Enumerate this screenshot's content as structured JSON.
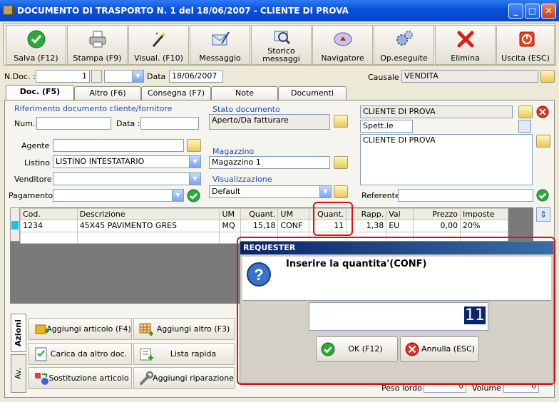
{
  "window": {
    "title": "DOCUMENTO DI TRASPORTO N. 1   del 18/06/2007 - CLIENTE DI PROVA"
  },
  "toolbar": [
    {
      "label": "Salva (F12)",
      "icon": "save-check-icon",
      "name": "save-button"
    },
    {
      "label": "Stampa (F9)",
      "icon": "printer-icon",
      "name": "print-button"
    },
    {
      "label": "Visual. (F10)",
      "icon": "magic-wand-icon",
      "name": "preview-button"
    },
    {
      "label": "Messaggio",
      "icon": "envelope-pen-icon",
      "name": "message-button"
    },
    {
      "label": "Storico messaggi",
      "icon": "message-history-icon",
      "name": "message-history-button"
    },
    {
      "label": "Navigatore",
      "icon": "compass-icon",
      "name": "navigator-button"
    },
    {
      "label": "Op.eseguite",
      "icon": "gears-icon",
      "name": "operations-button"
    },
    {
      "label": "Elimina",
      "icon": "red-x-icon",
      "name": "delete-button"
    },
    {
      "label": "Uscita (ESC)",
      "icon": "exit-icon",
      "name": "exit-button"
    }
  ],
  "header": {
    "ndoc_label": "N.Doc. :",
    "ndoc_value": "1",
    "data_label": "Data :",
    "data_value": "18/06/2007",
    "causale_label": "Causale :",
    "causale_value": "VENDITA"
  },
  "tabs": [
    "Doc. (F5)",
    "Altro (F6)",
    "Consegna (F7)",
    "Note",
    "Documenti"
  ],
  "rif": {
    "title": "Riferimento documento cliente/fornitore",
    "num_label": "Num.:",
    "num_value": "",
    "data_label": "Data :",
    "data_value": ""
  },
  "left": {
    "agente_label": "Agente :",
    "agente_value": "",
    "listino_label": "Listino :",
    "listino_value": "LISTINO INTESTATARIO",
    "venditore_label": "Venditore :",
    "venditore_value": "",
    "pagamento_label": "Pagamento :",
    "pagamento_value": ""
  },
  "stato": {
    "title": "Stato documento",
    "value": "Aperto/Da fatturare"
  },
  "magazzino": {
    "title": "Magazzino",
    "value": "Magazzino 1"
  },
  "visualizzazione": {
    "title": "Visualizzazione",
    "value": "Default"
  },
  "cliente": {
    "name": "CLIENTE DI PROVA",
    "salutation": "Spett.le",
    "address": "CLIENTE DI PROVA",
    "referente_label": "Referente",
    "referente_value": ""
  },
  "grid": {
    "headers": [
      "Cod.",
      "Descrizione",
      "UM",
      "Quant.",
      "UM",
      "Quant.",
      "Rapp.",
      "Val",
      "Prezzo",
      "Imposte"
    ],
    "rows": [
      [
        "1234",
        "45X45 PAVIMENTO GRES",
        "MQ",
        "15,18",
        "CONF",
        "11",
        "1,38",
        "EU",
        "0,00",
        "20%"
      ]
    ]
  },
  "side_tabs": [
    "Azioni",
    "Av."
  ],
  "actions": [
    "Aggiungi articolo (F4)",
    "Aggiungi altro (F3)",
    "Carica da altro doc.",
    "Lista rapida",
    "Sostituzione articolo",
    "Aggiungi riparazione"
  ],
  "footer": {
    "peso_label": "Peso lordo :",
    "peso_value": "0",
    "volume_label": "Volume :",
    "volume_value": "0"
  },
  "dialog": {
    "title": "REQUESTER",
    "prompt": "Inserire la quantita'(CONF)",
    "value": "11",
    "ok": "OK (F12)",
    "cancel": "Annulla (ESC)"
  },
  "colors": {
    "title_bar": "#0a4fd8",
    "dialog_title": "#0a246a",
    "highlight": "#e01010",
    "selection": "#0a246a"
  }
}
